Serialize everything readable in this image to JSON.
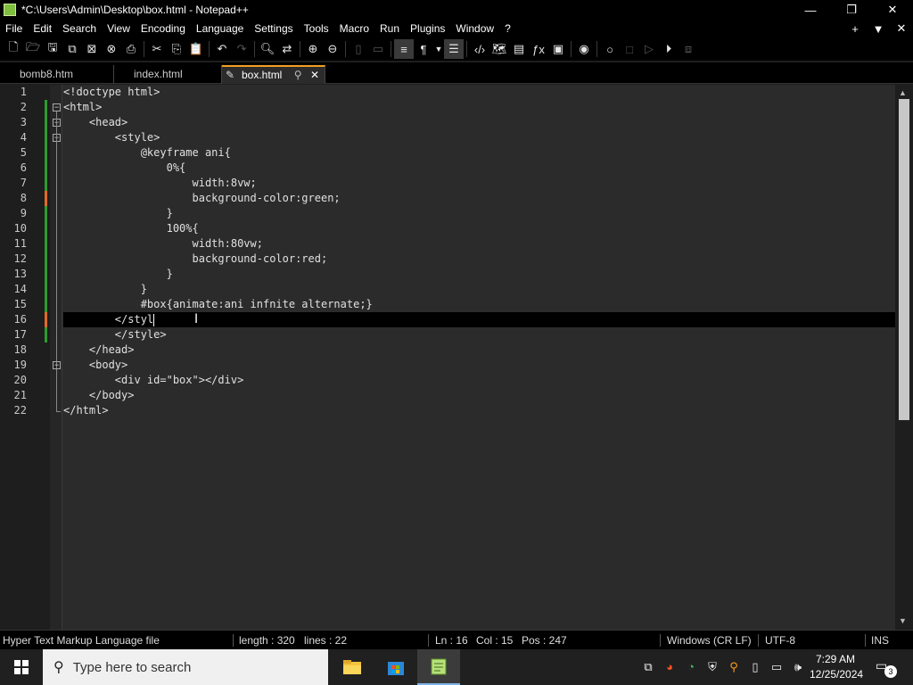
{
  "window": {
    "title": "*C:\\Users\\Admin\\Desktop\\box.html - Notepad++",
    "minimize": "—",
    "maximize": "❐",
    "close": "✕"
  },
  "menu": {
    "items": [
      "File",
      "Edit",
      "Search",
      "View",
      "Encoding",
      "Language",
      "Settings",
      "Tools",
      "Macro",
      "Run",
      "Plugins",
      "Window",
      "?"
    ],
    "right": [
      "+",
      "▼",
      "✕"
    ]
  },
  "toolbar": {
    "icons": [
      "new-file-icon",
      "open-file-icon",
      "save-icon",
      "save-all-icon",
      "close-icon",
      "close-all-icon",
      "print-icon",
      "cut-icon",
      "copy-icon",
      "paste-icon",
      "undo-icon",
      "redo-icon",
      "find-icon",
      "replace-icon",
      "zoom-in-icon",
      "zoom-out-icon",
      "sync-v-icon",
      "sync-h-icon",
      "word-wrap-icon",
      "show-all-chars-icon",
      "indent-guide-icon",
      "xml-tag-icon",
      "document-map-icon",
      "function-list-icon",
      "fx-icon",
      "folder-workspace-icon",
      "monitoring-icon",
      "record-macro-icon",
      "stop-macro-icon",
      "play-macro-icon",
      "run-macro-icon",
      "save-macro-icon"
    ]
  },
  "tabs": [
    {
      "label": "bomb8.htm"
    },
    {
      "label": "index.html"
    },
    {
      "label": "box.html",
      "active": true
    }
  ],
  "editor": {
    "lines": [
      "<!doctype html>",
      "<html>",
      "    <head>",
      "        <style>",
      "            @keyframe ani{",
      "                0%{",
      "                    width:8vw;",
      "                    background-color:green;",
      "                }",
      "                100%{",
      "                    width:80vw;",
      "                    background-color:red;",
      "                }",
      "            }",
      "            #box{animate:ani infnite alternate;}",
      "        </styl",
      "        </style>",
      "    </head>",
      "    <body>",
      "        <div id=\"box\"></div>",
      "    </body>",
      "</html>"
    ],
    "current_line": 16
  },
  "status": {
    "file_type": "Hyper Text Markup Language file",
    "length": "length : 320",
    "lines": "lines : 22",
    "ln": "Ln : 16",
    "col": "Col : 15",
    "pos": "Pos : 247",
    "eol": "Windows (CR LF)",
    "encoding": "UTF-8",
    "mode": "INS"
  },
  "taskbar": {
    "search_placeholder": "Type here to search",
    "time": "7:29 AM",
    "date": "12/25/2024",
    "notification_count": "3"
  }
}
